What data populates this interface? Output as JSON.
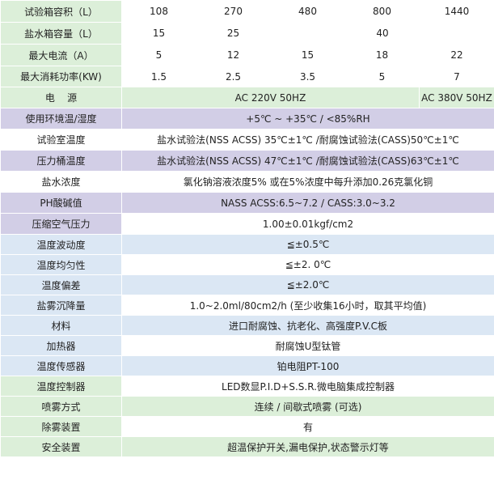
{
  "rows": [
    {
      "label": "试验箱容积（L）",
      "values": [
        "108",
        "270",
        "480",
        "800",
        "1440"
      ]
    },
    {
      "label": "盐水箱容量（L）",
      "values": [
        "15",
        "25",
        "40"
      ]
    },
    {
      "label": "最大电流（A）",
      "values": [
        "5",
        "12",
        "15",
        "18",
        "22"
      ]
    },
    {
      "label": "最大消耗功率(KW)",
      "values": [
        "1.5",
        "2.5",
        "3.5",
        "5",
        "7"
      ]
    },
    {
      "label": "电    源",
      "values": [
        "AC 220V 50HZ",
        "AC 380V 50HZ"
      ]
    },
    {
      "label": "使用环境温/湿度",
      "value": "+5℃ ~ +35℃ / <85%RH"
    },
    {
      "label": "试验室温度",
      "value": "盐水试验法(NSS ACSS) 35℃±1℃ /耐腐蚀试验法(CASS)50℃±1℃"
    },
    {
      "label": "压力桶温度",
      "value": "盐水试验法(NSS ACSS) 47℃±1℃ /耐腐蚀试验法(CASS)63℃±1℃"
    },
    {
      "label": "盐水浓度",
      "value": "氯化钠溶液浓度5% 或在5%浓度中每升添加0.26克氯化铜"
    },
    {
      "label": "PH酸碱值",
      "value": "NASS ACSS:6.5~7.2 / CASS:3.0~3.2"
    },
    {
      "label": "压缩空气压力",
      "value": "1.00±0.01kgf/cm2"
    },
    {
      "label": "温度波动度",
      "value": "≦±0.5℃"
    },
    {
      "label": "温度均匀性",
      "value": "≦±2. 0℃"
    },
    {
      "label": "温度偏差",
      "value": "≦±2.0℃"
    },
    {
      "label": "盐雾沉降量",
      "value": "1.0~2.0ml/80cm2/h (至少收集16小时，取其平均值)"
    },
    {
      "label": "材料",
      "value": "进口耐腐蚀、抗老化、高强度P.V.C板"
    },
    {
      "label": "加热器",
      "value": "耐腐蚀U型钛管"
    },
    {
      "label": "温度传感器",
      "value": "铂电阻PT-100"
    },
    {
      "label": "温度控制器",
      "value": "LED数显P.I.D+S.S.R.微电脑集成控制器"
    },
    {
      "label": "喷雾方式",
      "value": "连续 / 间歇式喷雾 (可选)"
    },
    {
      "label": "除雾装置",
      "value": "有"
    },
    {
      "label": "安全装置",
      "value": "超温保护开关,漏电保护,状态警示灯等"
    }
  ],
  "colors": {
    "green": "#dcefd9",
    "white": "#ffffff",
    "purple": "#d2cee6",
    "blue": "#dbe7f4",
    "border": "#ffffff",
    "text": "#222222"
  }
}
